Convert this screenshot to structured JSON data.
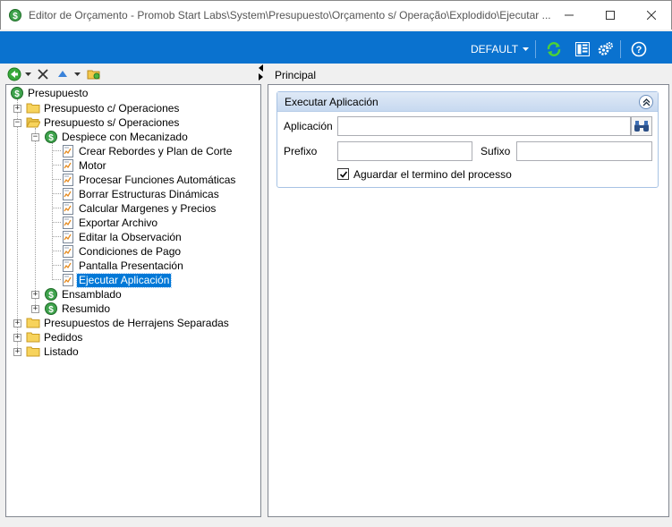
{
  "window": {
    "title": "Editor de Orçamento - Promob Start Labs\\System\\Presupuesto\\Orçamento s/ Operação\\Explodido\\Ejecutar ..."
  },
  "toolbar": {
    "profile_label": "DEFAULT",
    "icons": [
      "refresh-icon",
      "layout-icon",
      "settings-icon",
      "help-icon"
    ]
  },
  "tree": {
    "root": "Presupuesto",
    "items": {
      "c_operaciones": "Presupuesto c/ Operaciones",
      "s_operaciones": "Presupuesto s/ Operaciones",
      "despiece": "Despiece con Mecanizado",
      "children": [
        "Crear Rebordes y Plan de Corte",
        "Motor",
        "Procesar Funciones Automáticas",
        "Borrar Estructuras Dinámicas",
        "Calcular Margenes y Precios",
        "Exportar Archivo",
        "Editar la Observación",
        "Condiciones de Pago",
        "Pantalla Presentación",
        "Ejecutar Aplicación"
      ],
      "ensamblado": "Ensamblado",
      "resumido": "Resumido",
      "herrajens": "Presupuestos de Herrajens Separadas",
      "pedidos": "Pedidos",
      "listado": "Listado"
    },
    "selected": "Ejecutar Aplicación"
  },
  "main": {
    "tab": "Principal",
    "group_title": "Executar Aplicación",
    "fields": {
      "aplicacion_label": "Aplicación",
      "aplicacion_value": "",
      "prefixo_label": "Prefixo",
      "prefixo_value": "",
      "sufixo_label": "Sufixo",
      "sufixo_value": "",
      "aguardar_label": "Aguardar el termino del processo",
      "aguardar_checked": true
    }
  }
}
